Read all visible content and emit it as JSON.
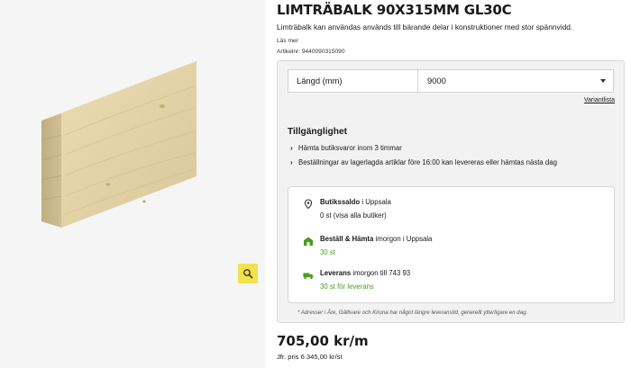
{
  "product": {
    "title": "LIMTRÄBALK 90X315MM GL30C",
    "description": "Limträbalk kan användas används till bärande delar i konstruktioner med stor spännvidd.",
    "read_more": "Läs mer",
    "article_number": "Artikelnr: 9440090315090"
  },
  "image": {
    "alt": "glulam-beam-image",
    "zoom_icon": "magnifier-icon"
  },
  "options": {
    "length_label": "Längd (mm)",
    "length_value": "9000",
    "variant_link": "Variantlista"
  },
  "availability": {
    "title": "Tillgänglighet",
    "items": [
      "Hämta butiksvaror inom 3 timmar",
      "Beställningar av lagerlagda artiklar före 16:00 kan levereras eller hämtas nästa dag"
    ],
    "store_stock": {
      "label": "Butikssaldo",
      "location_text": " i Uppsala",
      "value": "0 st (visa alla butiker)"
    },
    "click_collect": {
      "label": "Beställ & Hämta",
      "location_text": " imorgon i Uppsala",
      "value": "30 st"
    },
    "delivery": {
      "label": "Leverans",
      "location_text": " imorgon till 743 93",
      "value": "30 st för leverans"
    },
    "footnote": "* Adresser i Åre, Gällivare och Kiruna har något längre leveranstid, generellt ytterligare en dag."
  },
  "pricing": {
    "price": "705,00 kr/m",
    "comparison": "Jfr. pris   6 345,00 kr/st"
  },
  "colors": {
    "accent_yellow": "#f2e24a",
    "stock_green": "#4a9d1e",
    "wood_face": "#e6d7ae",
    "wood_side": "#c9b88c"
  }
}
